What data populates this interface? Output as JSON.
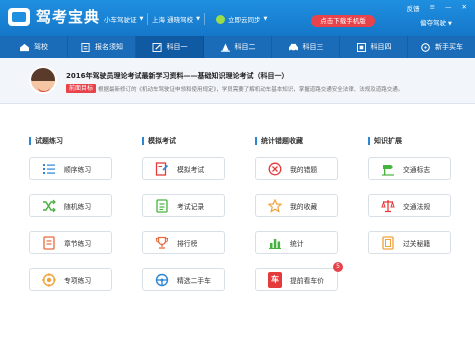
{
  "header": {
    "app_name": "驾考宝典",
    "car_type": "小车驾驶证",
    "school": "上海 通晓驾校",
    "login": "立即云同步",
    "cta": "点击下载手机版",
    "feedback": "反馈",
    "user": "偏夺驾驶",
    "colors": {
      "primary": "#1f8fe0",
      "nav": "#1b6cb8",
      "accent": "#e8424a"
    }
  },
  "nav": [
    {
      "label": "驾校",
      "icon": "home-icon"
    },
    {
      "label": "报名须知",
      "icon": "document-icon"
    },
    {
      "label": "科目一",
      "icon": "pencil-icon",
      "active": true
    },
    {
      "label": "科目二",
      "icon": "cone-icon"
    },
    {
      "label": "科目三",
      "icon": "car-icon"
    },
    {
      "label": "科目四",
      "icon": "book-icon"
    },
    {
      "label": "新手买车",
      "icon": "wheel-icon"
    }
  ],
  "banner": {
    "title": "2016年驾驶员理论考试最新学习资料——基础知识理论考试（科目一）",
    "tag": "前面目标",
    "text": "根据最新修订的《机动车驾驶证申领和使用规定》，学员需要了解机动车基本知识，掌握道路交通安全法律、法规及道路交通。"
  },
  "sections": {
    "practice": {
      "title": "试题练习",
      "items": [
        "顺序练习",
        "随机练习",
        "章节练习",
        "专项练习"
      ]
    },
    "exam": {
      "title": "模拟考试",
      "items": [
        "模拟考试",
        "考试记录",
        "排行榜",
        "精选二手车"
      ]
    },
    "stats": {
      "title": "统计错题收藏",
      "items": [
        "我的错题",
        "我的收藏",
        "统计",
        "提前看车价"
      ],
      "badge": "5",
      "car_tag": "车"
    },
    "knowledge": {
      "title": "知识扩展",
      "items": [
        "交通标志",
        "交通法规",
        "过关秘籍"
      ]
    }
  }
}
